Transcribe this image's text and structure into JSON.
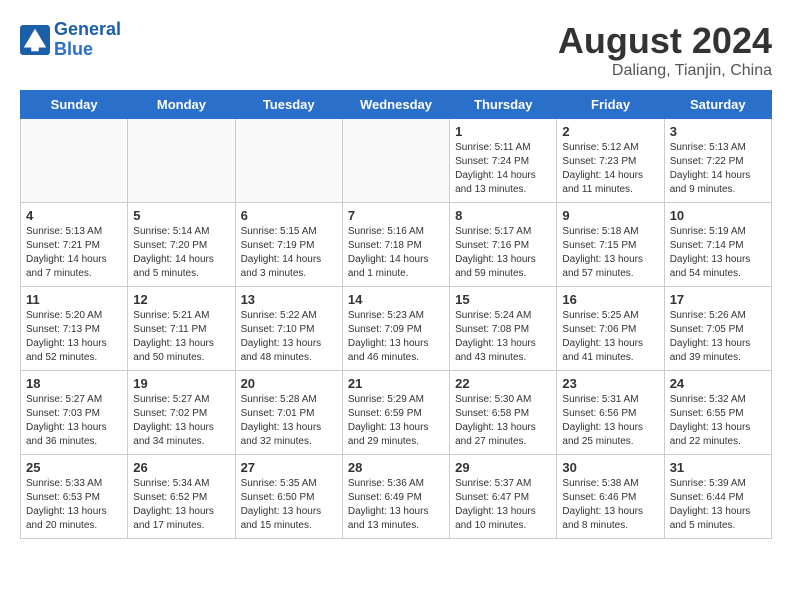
{
  "header": {
    "logo_line1": "General",
    "logo_line2": "Blue",
    "month_year": "August 2024",
    "location": "Daliang, Tianjin, China"
  },
  "days_of_week": [
    "Sunday",
    "Monday",
    "Tuesday",
    "Wednesday",
    "Thursday",
    "Friday",
    "Saturday"
  ],
  "weeks": [
    [
      {
        "day": "",
        "info": ""
      },
      {
        "day": "",
        "info": ""
      },
      {
        "day": "",
        "info": ""
      },
      {
        "day": "",
        "info": ""
      },
      {
        "day": "1",
        "info": "Sunrise: 5:11 AM\nSunset: 7:24 PM\nDaylight: 14 hours\nand 13 minutes."
      },
      {
        "day": "2",
        "info": "Sunrise: 5:12 AM\nSunset: 7:23 PM\nDaylight: 14 hours\nand 11 minutes."
      },
      {
        "day": "3",
        "info": "Sunrise: 5:13 AM\nSunset: 7:22 PM\nDaylight: 14 hours\nand 9 minutes."
      }
    ],
    [
      {
        "day": "4",
        "info": "Sunrise: 5:13 AM\nSunset: 7:21 PM\nDaylight: 14 hours\nand 7 minutes."
      },
      {
        "day": "5",
        "info": "Sunrise: 5:14 AM\nSunset: 7:20 PM\nDaylight: 14 hours\nand 5 minutes."
      },
      {
        "day": "6",
        "info": "Sunrise: 5:15 AM\nSunset: 7:19 PM\nDaylight: 14 hours\nand 3 minutes."
      },
      {
        "day": "7",
        "info": "Sunrise: 5:16 AM\nSunset: 7:18 PM\nDaylight: 14 hours\nand 1 minute."
      },
      {
        "day": "8",
        "info": "Sunrise: 5:17 AM\nSunset: 7:16 PM\nDaylight: 13 hours\nand 59 minutes."
      },
      {
        "day": "9",
        "info": "Sunrise: 5:18 AM\nSunset: 7:15 PM\nDaylight: 13 hours\nand 57 minutes."
      },
      {
        "day": "10",
        "info": "Sunrise: 5:19 AM\nSunset: 7:14 PM\nDaylight: 13 hours\nand 54 minutes."
      }
    ],
    [
      {
        "day": "11",
        "info": "Sunrise: 5:20 AM\nSunset: 7:13 PM\nDaylight: 13 hours\nand 52 minutes."
      },
      {
        "day": "12",
        "info": "Sunrise: 5:21 AM\nSunset: 7:11 PM\nDaylight: 13 hours\nand 50 minutes."
      },
      {
        "day": "13",
        "info": "Sunrise: 5:22 AM\nSunset: 7:10 PM\nDaylight: 13 hours\nand 48 minutes."
      },
      {
        "day": "14",
        "info": "Sunrise: 5:23 AM\nSunset: 7:09 PM\nDaylight: 13 hours\nand 46 minutes."
      },
      {
        "day": "15",
        "info": "Sunrise: 5:24 AM\nSunset: 7:08 PM\nDaylight: 13 hours\nand 43 minutes."
      },
      {
        "day": "16",
        "info": "Sunrise: 5:25 AM\nSunset: 7:06 PM\nDaylight: 13 hours\nand 41 minutes."
      },
      {
        "day": "17",
        "info": "Sunrise: 5:26 AM\nSunset: 7:05 PM\nDaylight: 13 hours\nand 39 minutes."
      }
    ],
    [
      {
        "day": "18",
        "info": "Sunrise: 5:27 AM\nSunset: 7:03 PM\nDaylight: 13 hours\nand 36 minutes."
      },
      {
        "day": "19",
        "info": "Sunrise: 5:27 AM\nSunset: 7:02 PM\nDaylight: 13 hours\nand 34 minutes."
      },
      {
        "day": "20",
        "info": "Sunrise: 5:28 AM\nSunset: 7:01 PM\nDaylight: 13 hours\nand 32 minutes."
      },
      {
        "day": "21",
        "info": "Sunrise: 5:29 AM\nSunset: 6:59 PM\nDaylight: 13 hours\nand 29 minutes."
      },
      {
        "day": "22",
        "info": "Sunrise: 5:30 AM\nSunset: 6:58 PM\nDaylight: 13 hours\nand 27 minutes."
      },
      {
        "day": "23",
        "info": "Sunrise: 5:31 AM\nSunset: 6:56 PM\nDaylight: 13 hours\nand 25 minutes."
      },
      {
        "day": "24",
        "info": "Sunrise: 5:32 AM\nSunset: 6:55 PM\nDaylight: 13 hours\nand 22 minutes."
      }
    ],
    [
      {
        "day": "25",
        "info": "Sunrise: 5:33 AM\nSunset: 6:53 PM\nDaylight: 13 hours\nand 20 minutes."
      },
      {
        "day": "26",
        "info": "Sunrise: 5:34 AM\nSunset: 6:52 PM\nDaylight: 13 hours\nand 17 minutes."
      },
      {
        "day": "27",
        "info": "Sunrise: 5:35 AM\nSunset: 6:50 PM\nDaylight: 13 hours\nand 15 minutes."
      },
      {
        "day": "28",
        "info": "Sunrise: 5:36 AM\nSunset: 6:49 PM\nDaylight: 13 hours\nand 13 minutes."
      },
      {
        "day": "29",
        "info": "Sunrise: 5:37 AM\nSunset: 6:47 PM\nDaylight: 13 hours\nand 10 minutes."
      },
      {
        "day": "30",
        "info": "Sunrise: 5:38 AM\nSunset: 6:46 PM\nDaylight: 13 hours\nand 8 minutes."
      },
      {
        "day": "31",
        "info": "Sunrise: 5:39 AM\nSunset: 6:44 PM\nDaylight: 13 hours\nand 5 minutes."
      }
    ]
  ]
}
